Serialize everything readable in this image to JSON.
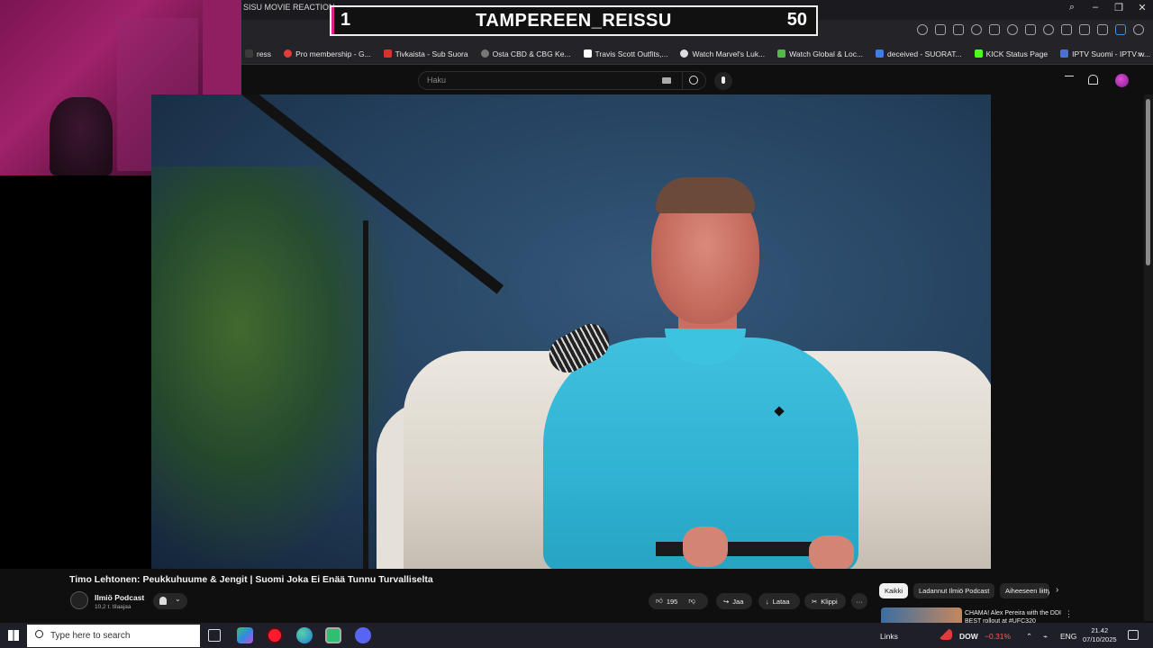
{
  "browser": {
    "tab_title": "SISU MOVIE REACTION -",
    "bookmarks": [
      {
        "label": "ress",
        "color": "#3a3a3a"
      },
      {
        "label": "Pro membership - G...",
        "color": "#e23d3d"
      },
      {
        "label": "Tivkaista - Sub Suora",
        "color": "#d6332b"
      },
      {
        "label": "Osta CBD & CBG Ke...",
        "color": "#777777"
      },
      {
        "label": "Travis Scott Outfits,...",
        "color": "#ffffff"
      },
      {
        "label": "Watch Marvel's Luk...",
        "color": "#dddddd"
      },
      {
        "label": "Watch Global & Loc...",
        "color": "#53b848"
      },
      {
        "label": "deceived - SUORAT...",
        "color": "#3d7ee0"
      },
      {
        "label": "KICK Status Page",
        "color": "#53fc18"
      },
      {
        "label": "IPTV Suomi - IPTV w...",
        "color": "#4b6fd6"
      }
    ],
    "bookmarks_more": "»"
  },
  "overlay": {
    "left_number": "1",
    "title": "TAMPEREEN_REISSU",
    "right_number": "50",
    "accent": "#e0218a"
  },
  "youtube": {
    "search_placeholder": "Haku",
    "video_title": "Timo Lehtonen: Peukkuhuume & Jengit | Suomi Joka Ei Enää Tunnu Turvalliselta",
    "channel_name": "Ilmiö Podcast",
    "channel_subs": "10,2 t. tilaajaa",
    "likes": "195",
    "share_label": "Jaa",
    "download_label": "Lataa",
    "clip_label": "Klippi",
    "more_label": "···",
    "chips": {
      "all": "Kaikki",
      "channel": "Ladannut Ilmiö Podcast",
      "related": "Aiheeseen liittyvät"
    },
    "recommended_title": "CHAMA! Alex Pereira with the DDI BEST rollout at #UFC320"
  },
  "taskbar": {
    "search_placeholder": "Type here to search",
    "links": "Links",
    "ticker_name": "DOW",
    "ticker_change": "−0.31%",
    "lang": "ENG",
    "time": "21.42",
    "date": "07/10/2025"
  }
}
